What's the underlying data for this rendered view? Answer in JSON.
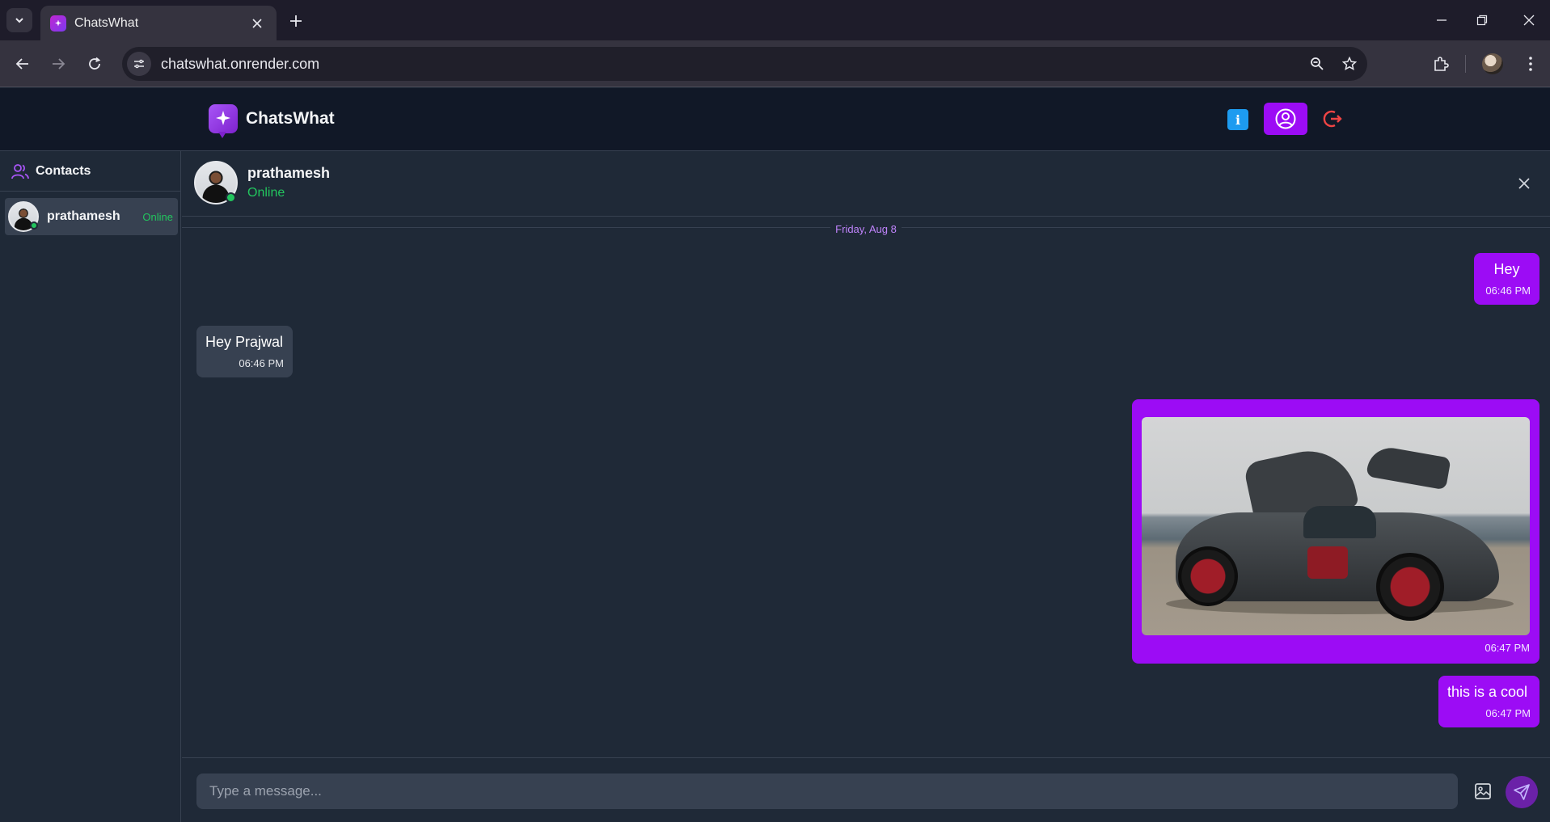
{
  "browser": {
    "tab_title": "ChatsWhat",
    "url": "chatswhat.onrender.com",
    "icons": [
      "tab-search-icon",
      "close-icon",
      "plus-icon",
      "minimize-icon",
      "restore-icon",
      "close-icon",
      "back-icon",
      "forward-icon",
      "reload-icon",
      "site-info-icon",
      "zoom-icon",
      "star-icon",
      "extensions-icon",
      "profile-avatar",
      "menu-dots-icon"
    ]
  },
  "app": {
    "brand": "ChatsWhat",
    "header_icons": [
      "info-icon",
      "user-circle-icon",
      "logout-icon"
    ],
    "accent_color": "#9c0cf5"
  },
  "sidebar": {
    "title": "Contacts",
    "contacts": [
      {
        "name": "prathamesh",
        "status": "Online"
      }
    ]
  },
  "chat": {
    "contact_name": "prathamesh",
    "contact_status": "Online",
    "date_label": "Friday, Aug 8",
    "messages": [
      {
        "direction": "out",
        "text": "Hey",
        "time": "06:46 PM"
      },
      {
        "direction": "in",
        "text": "Hey Prajwal",
        "time": "06:46 PM"
      },
      {
        "direction": "out",
        "type": "image",
        "image_subject": "grey sports car with open gullwing doors by the sea",
        "time": "06:47 PM"
      },
      {
        "direction": "out",
        "text": "this is a cool",
        "time": "06:47 PM"
      }
    ]
  },
  "composer": {
    "placeholder": "Type a message..."
  }
}
